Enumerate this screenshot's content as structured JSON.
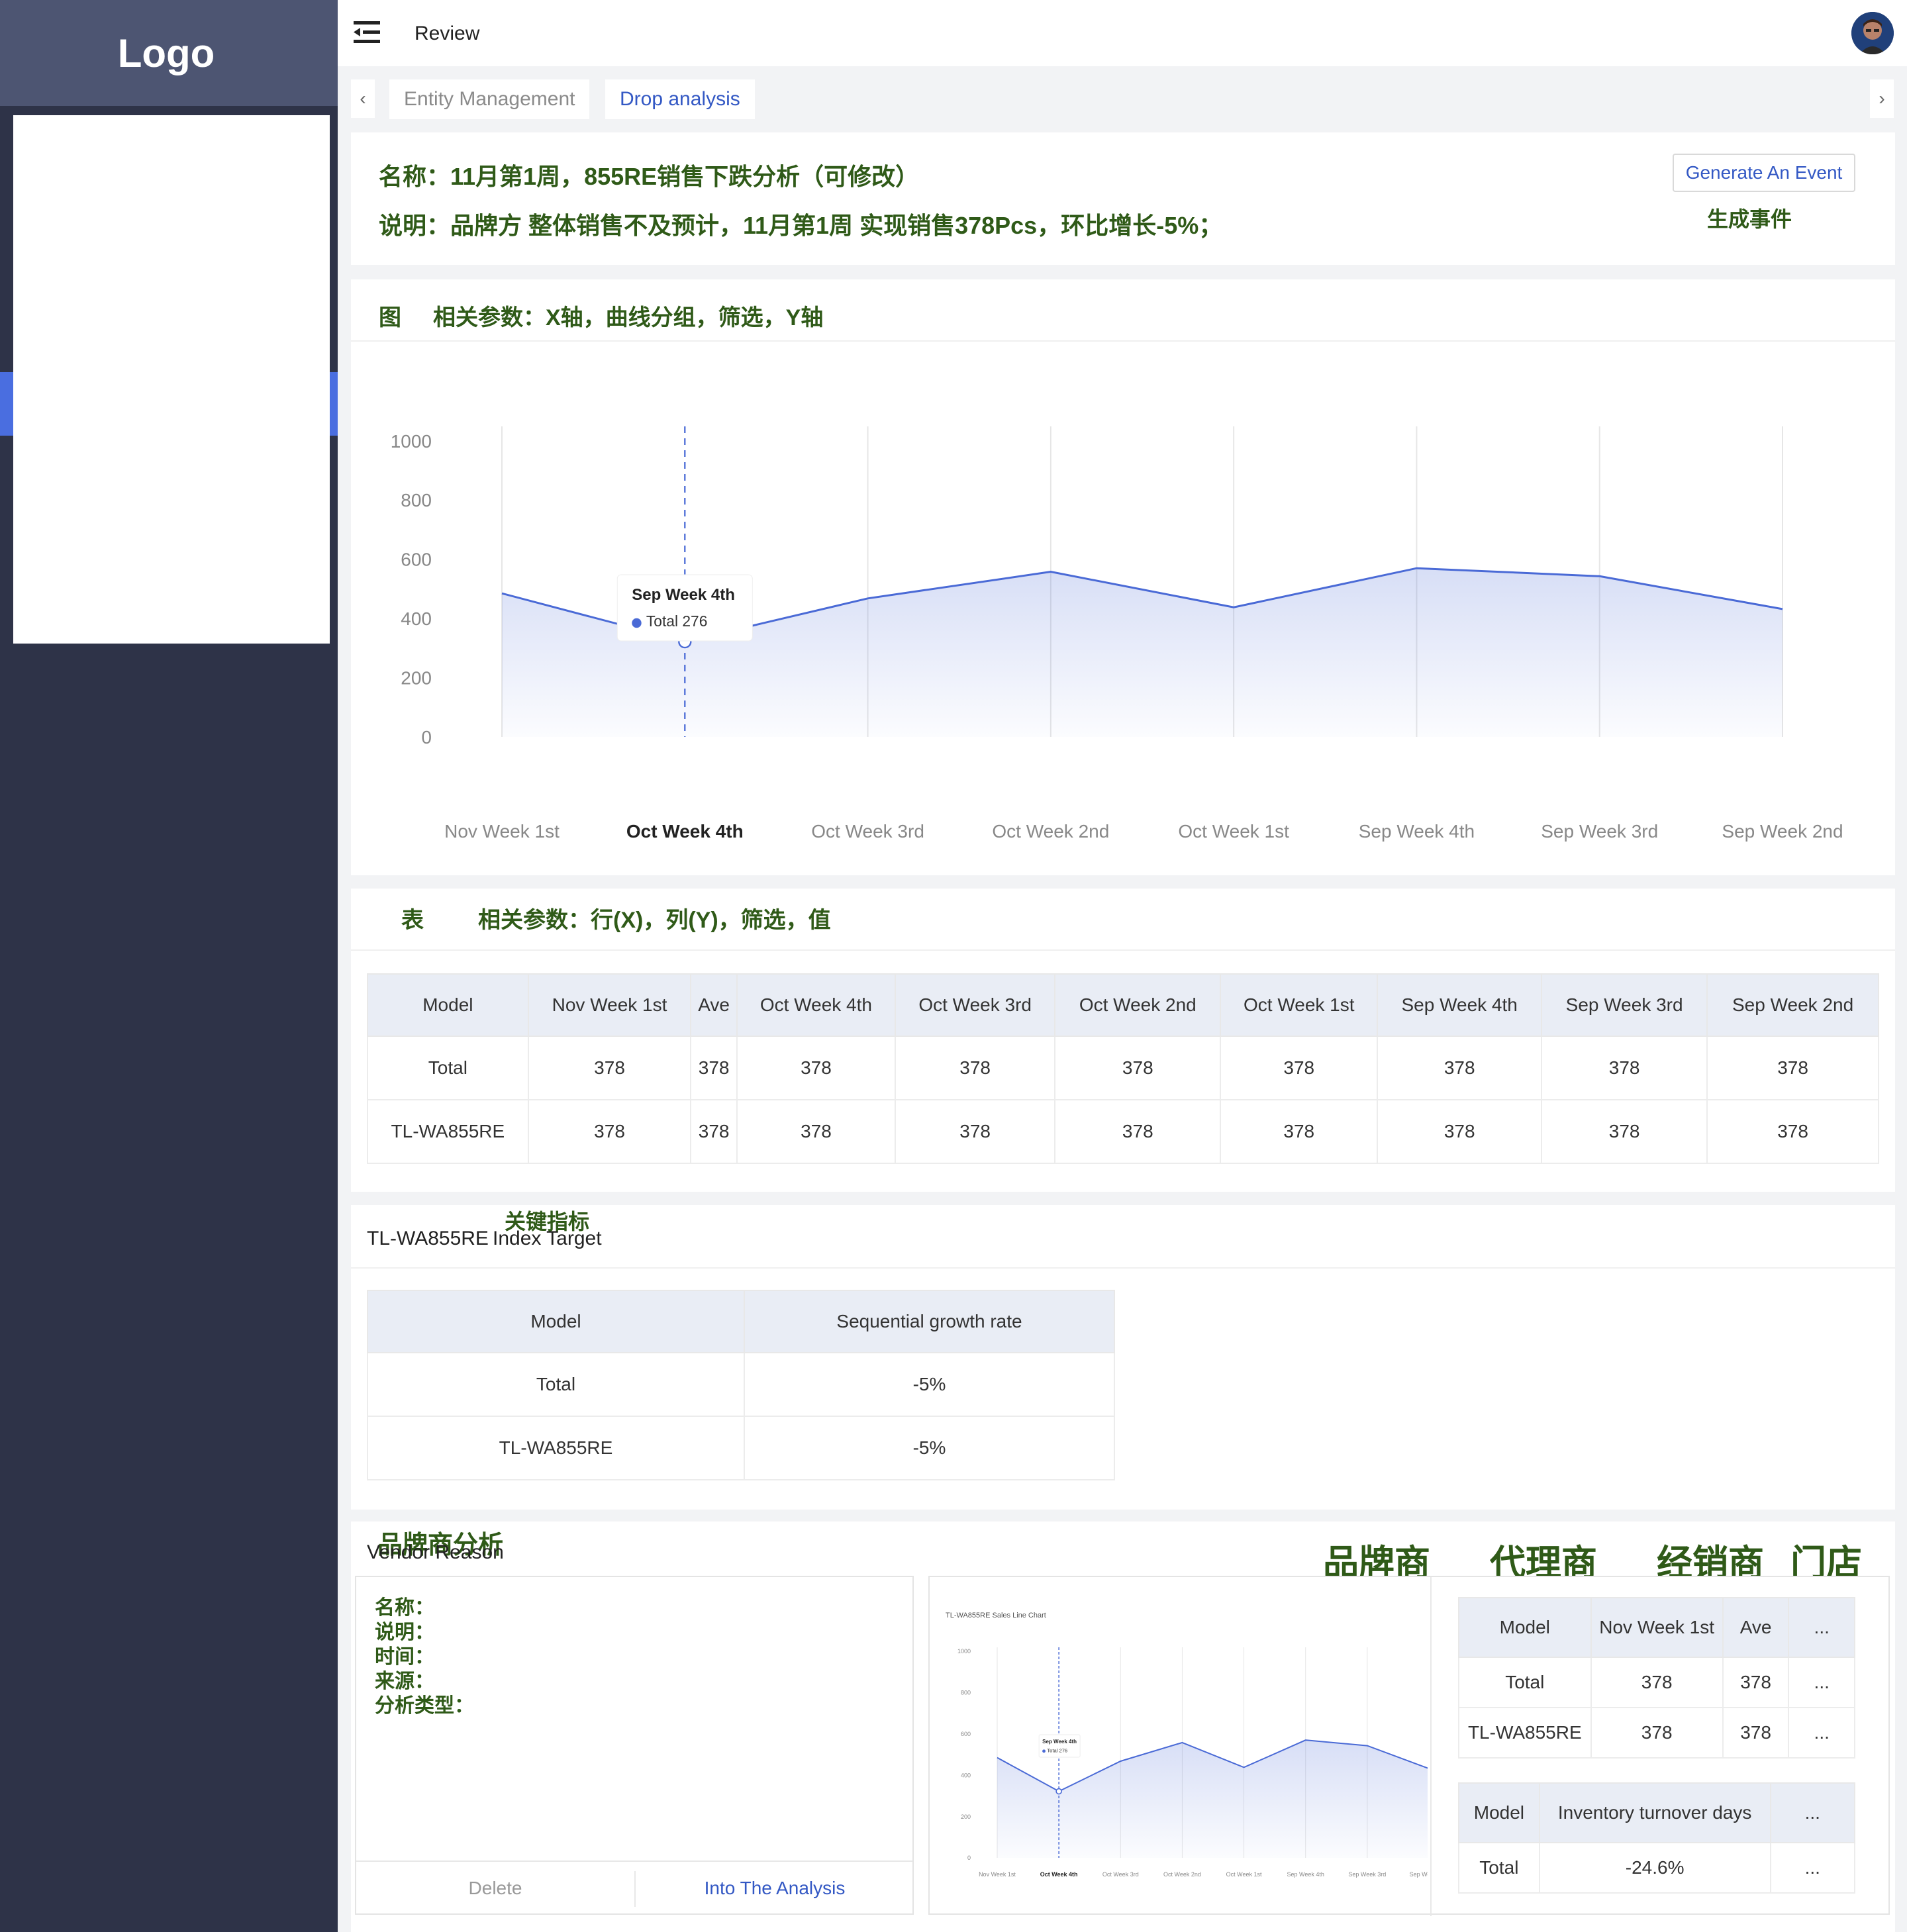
{
  "sidebar": {
    "logo": "Logo"
  },
  "header": {
    "title": "Review"
  },
  "tabs": [
    {
      "label": "Entity Management"
    },
    {
      "label": "Drop analysis"
    }
  ],
  "summary": {
    "name_line": "名称：11月第1周，855RE销售下跌分析（可修改）",
    "desc_line": "说明：品牌方 整体销售不及预计，11月第1周 实现销售378Pcs，环比增长-5%；",
    "button_label": "Generate An Event",
    "button_caption": "生成事件"
  },
  "chart_section": {
    "heading_icon_label": "图",
    "heading": "相关参数：X轴，曲线分组，筛选，Y轴",
    "tooltip": {
      "title": "Sep Week 4th",
      "series": "Total",
      "value": "276"
    }
  },
  "chart_data": {
    "type": "area",
    "categories": [
      "Nov Week 1st",
      "Oct Week 4th",
      "Oct Week 3rd",
      "Oct Week 2nd",
      "Oct Week 1st",
      "Sep Week 4th",
      "Sep Week 3rd",
      "Sep Week 2nd"
    ],
    "series": [
      {
        "name": "Total",
        "values": [
          485,
          322,
          468,
          558,
          438,
          570,
          543,
          432
        ]
      }
    ],
    "ylim": [
      0,
      1000
    ],
    "yticks": [
      0,
      200,
      400,
      600,
      800,
      1000
    ],
    "highlight_category": "Oct Week 4th",
    "color": "#4a6ad6",
    "grid": true
  },
  "table_section": {
    "heading_icon_label": "表",
    "heading": "相关参数：行(X)，列(Y)，筛选，值",
    "columns": [
      "Model",
      "Nov Week 1st",
      "Ave",
      "Oct Week 4th",
      "Oct Week 3rd",
      "Oct Week 2nd",
      "Oct Week 1st",
      "Sep Week 4th",
      "Sep Week 3rd",
      "Sep Week 2nd"
    ],
    "rows": [
      [
        "Total",
        "378",
        "378",
        "378",
        "378",
        "378",
        "378",
        "378",
        "378",
        "378"
      ],
      [
        "TL-WA855RE",
        "378",
        "378",
        "378",
        "378",
        "378",
        "378",
        "378",
        "378",
        "378"
      ]
    ]
  },
  "index_section": {
    "caption_cn": "关键指标",
    "model_name": "TL-WA855RE",
    "title": "Index Target",
    "columns": [
      "Model",
      "Sequential growth rate"
    ],
    "rows": [
      [
        "Total",
        "-5%"
      ],
      [
        "TL-WA855RE",
        "-5%"
      ]
    ]
  },
  "vendor_section": {
    "caption_cn": "品牌商分析",
    "title": "Vendor Reason",
    "categories": [
      "品牌商",
      "代理商",
      "经销商",
      "门店"
    ],
    "card_fields": [
      "名称：",
      "说明：",
      "时间：",
      "来源：",
      "分析类型："
    ],
    "delete_label": "Delete",
    "analysis_label": "Into The Analysis",
    "mini_chart_title": "TL-WA855RE Sales Line Chart",
    "mini_table1": {
      "columns": [
        "Model",
        "Nov Week 1st",
        "Ave",
        "..."
      ],
      "rows": [
        [
          "Total",
          "378",
          "378",
          "..."
        ],
        [
          "TL-WA855RE",
          "378",
          "378",
          "..."
        ]
      ]
    },
    "mini_table2": {
      "columns": [
        "Model",
        "Inventory turnover days",
        "..."
      ],
      "rows": [
        [
          "Total",
          "-24.6%",
          "..."
        ]
      ]
    }
  }
}
